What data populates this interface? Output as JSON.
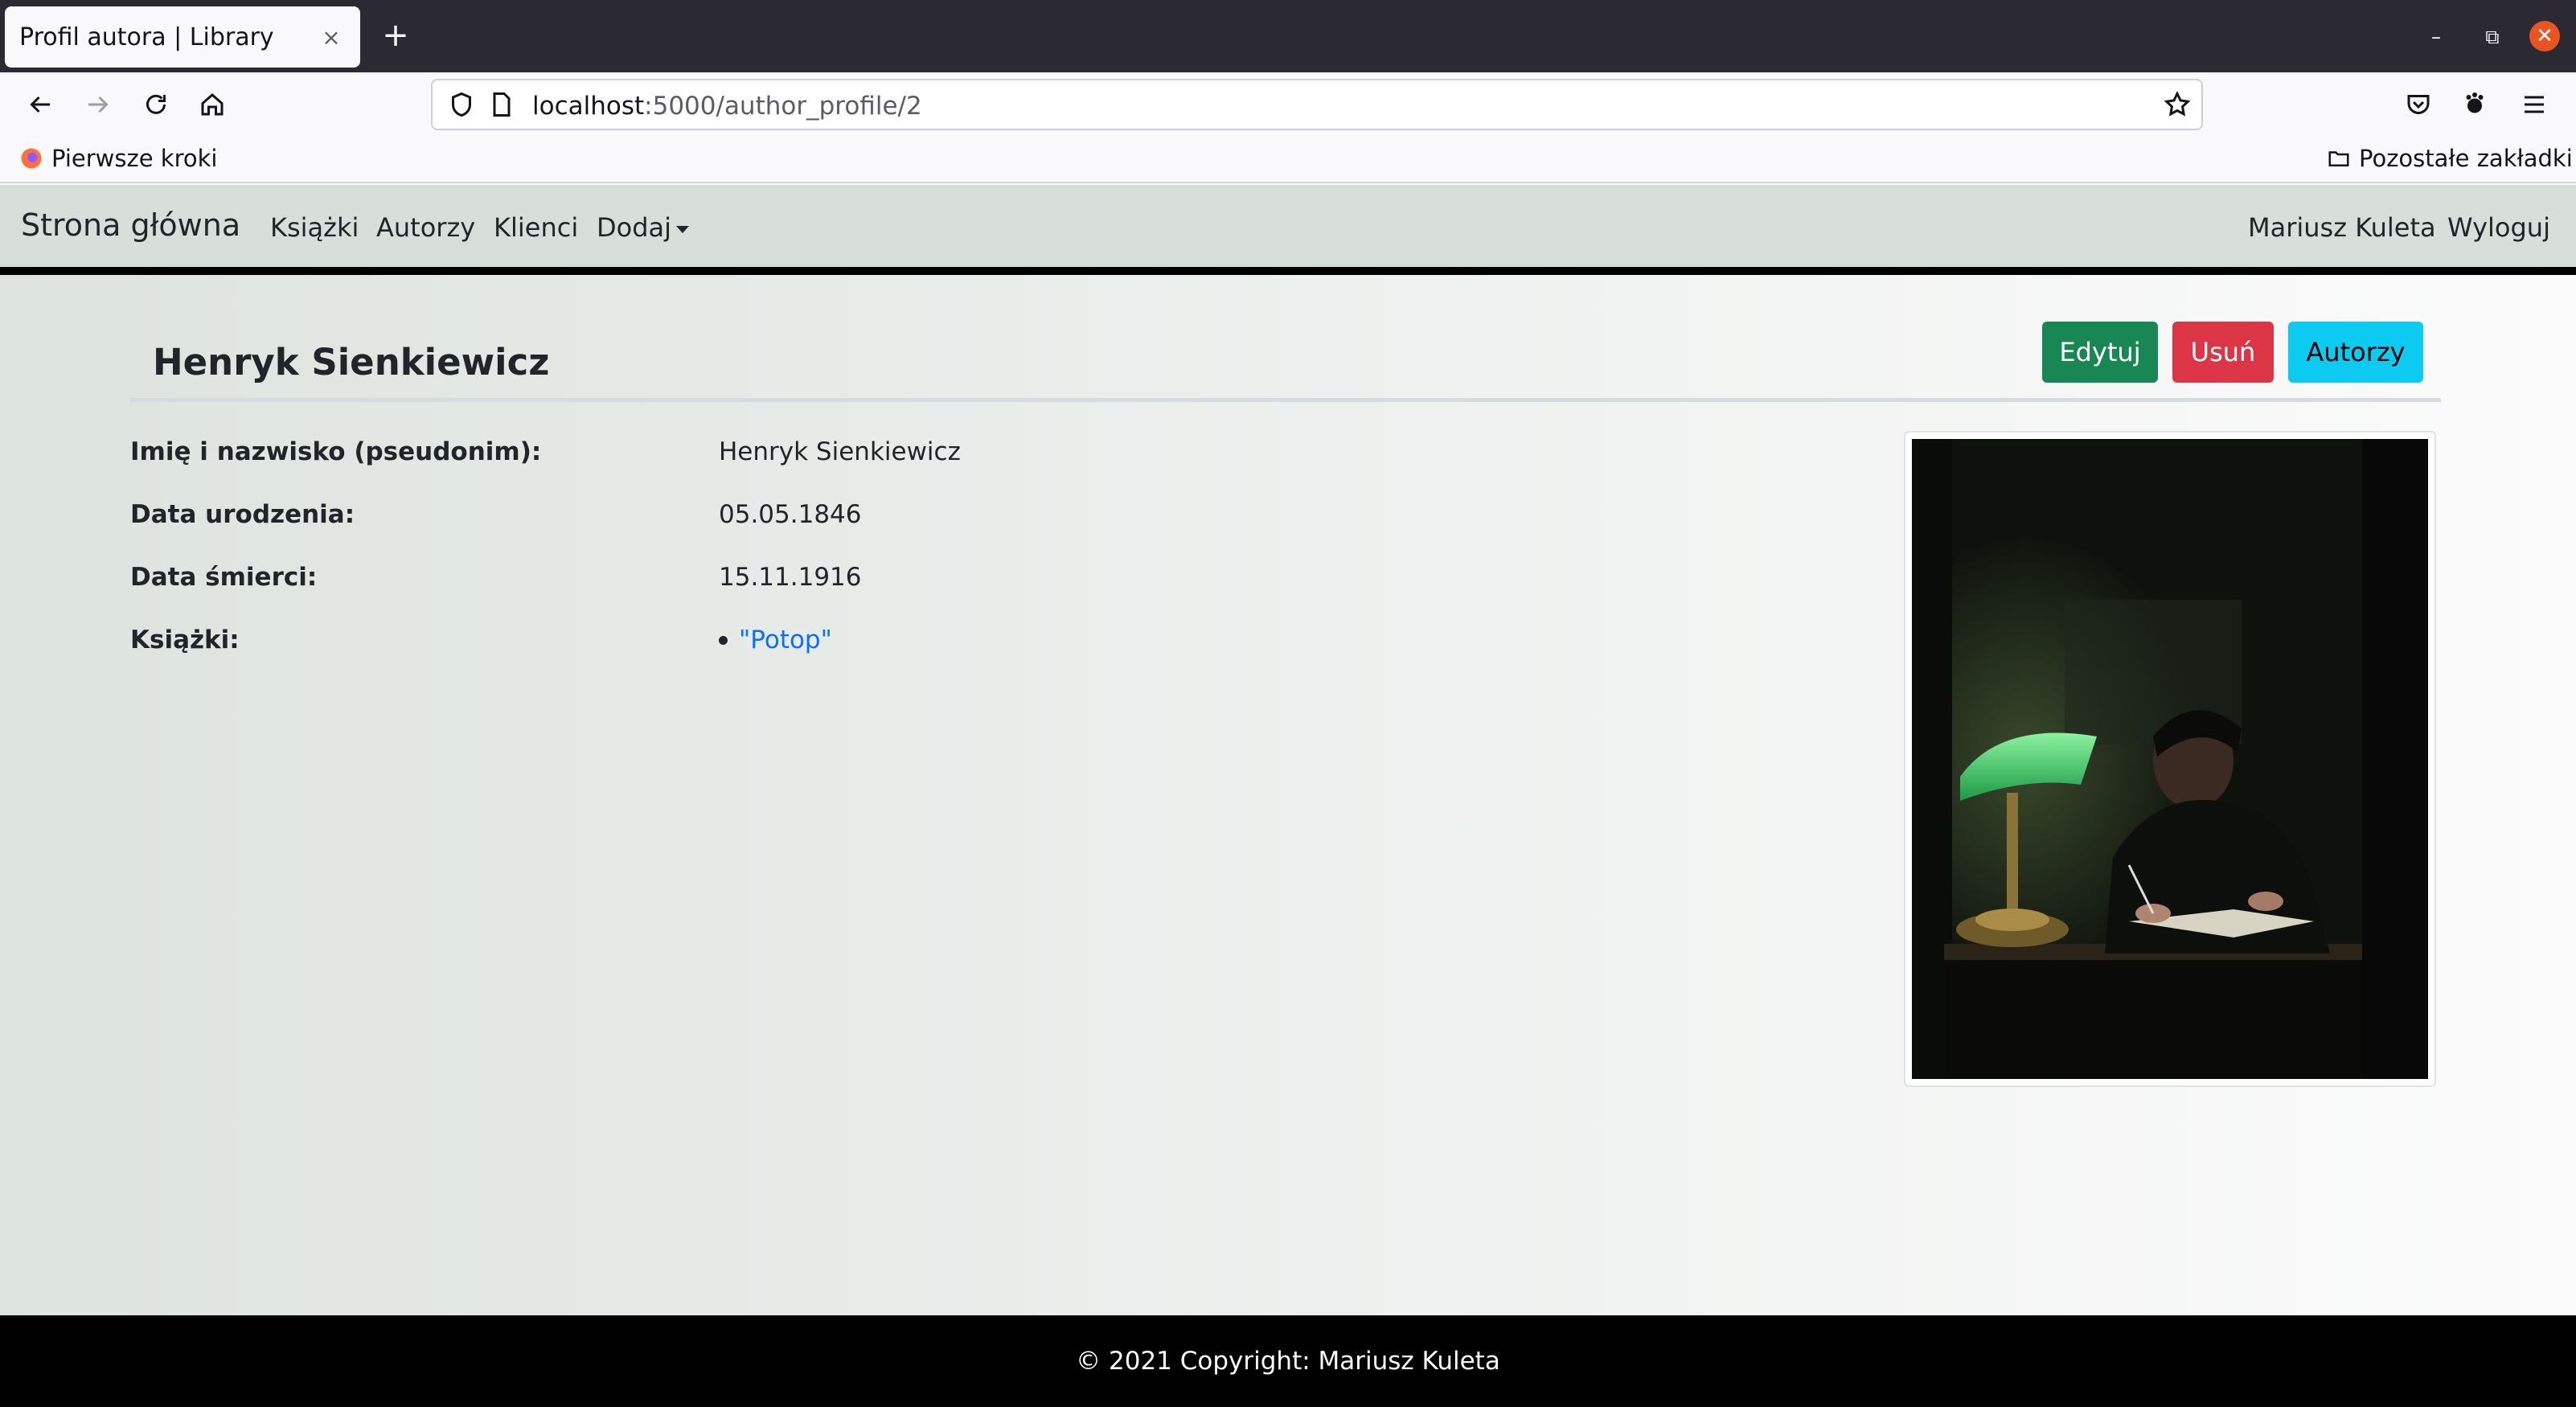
{
  "browser": {
    "tab_title": "Profil autora | Library",
    "tab_close": "×",
    "new_tab": "+",
    "url_host": "localhost",
    "url_rest": ":5000/author_profile/2",
    "bookmarks": {
      "left": "Pierwsze kroki",
      "right": "Pozostałe zakładki"
    }
  },
  "site_nav": {
    "brand": "Strona główna",
    "links": [
      "Książki",
      "Autorzy",
      "Klienci",
      "Dodaj"
    ],
    "user": "Mariusz Kuleta",
    "logout": "Wyloguj"
  },
  "author": {
    "title": "Henryk Sienkiewicz",
    "buttons": {
      "edit": "Edytuj",
      "delete": "Usuń",
      "authors": "Autorzy"
    },
    "fields": [
      {
        "label": "Imię i nazwisko (pseudonim):",
        "value": "Henryk Sienkiewicz"
      },
      {
        "label": "Data urodzenia:",
        "value": "05.05.1846"
      },
      {
        "label": "Data śmierci:",
        "value": "15.11.1916"
      },
      {
        "label": "Książki:",
        "books": [
          "\"Potop\""
        ]
      }
    ]
  },
  "footer": {
    "text": "© 2021 Copyright: Mariusz Kuleta"
  },
  "colors": {
    "edit": "#198754",
    "delete": "#dc3545",
    "authors": "#0dcaf0",
    "link": "#0d6efd"
  }
}
